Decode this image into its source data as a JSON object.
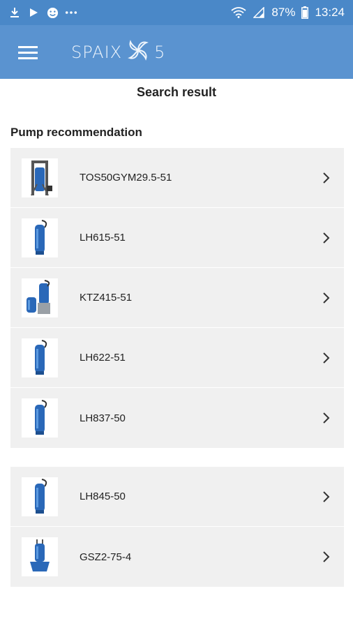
{
  "status_bar": {
    "battery": "87%",
    "time": "13:24",
    "icons": [
      "download-icon",
      "play-store-icon",
      "emoji-icon",
      "more-dots-icon",
      "wifi-icon",
      "signal-icon",
      "battery-icon"
    ]
  },
  "app_bar": {
    "menu_icon": "hamburger-menu-icon",
    "logo_left": "SPAIX",
    "logo_right": "5"
  },
  "page": {
    "title": "Search result",
    "section_title": "Pump recommendation"
  },
  "results_group_1": [
    {
      "name": "TOS50GYM29.5-51",
      "image": "pump-frame-image"
    },
    {
      "name": "LH615-51",
      "image": "pump-tall-image"
    },
    {
      "name": "KTZ415-51",
      "image": "pump-pair-image"
    },
    {
      "name": "LH622-51",
      "image": "pump-tall-image"
    },
    {
      "name": "LH837-50",
      "image": "pump-tall-image"
    }
  ],
  "results_group_2": [
    {
      "name": "LH845-50",
      "image": "pump-tall-image"
    },
    {
      "name": "GSZ2-75-4",
      "image": "pump-wide-base-image"
    }
  ],
  "colors": {
    "status_bar": "#4a88c8",
    "app_bar": "#5a93d0",
    "list_background": "#f0f0f0",
    "pump_blue": "#2a68b8"
  }
}
